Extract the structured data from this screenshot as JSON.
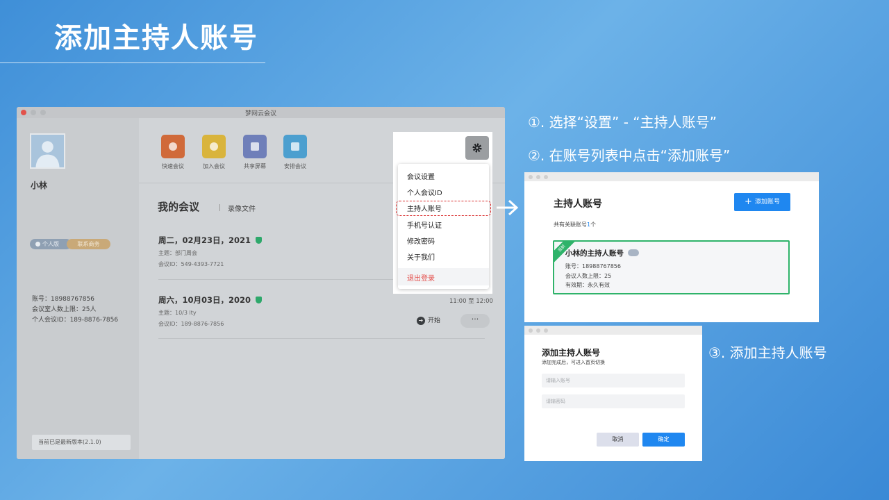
{
  "slide": {
    "title": "添加主持人账号"
  },
  "app": {
    "window_title": "梦网云会议",
    "user": {
      "name": "小林",
      "edition": "个人版",
      "business_contact": "联系商务",
      "account_line": "账号：18988767856",
      "capacity_line": "会议室人数上限：25人",
      "personal_id_line": "个人会议ID：189-8876-7856"
    },
    "version": "当前已是最新版本(2.1.0)",
    "quick_actions": [
      {
        "label": "快速会议",
        "color": "#d06a3a",
        "icon": "camera-icon"
      },
      {
        "label": "加入会议",
        "color": "#d9b43c",
        "icon": "plus-circle-icon"
      },
      {
        "label": "共享屏幕",
        "color": "#6f7fb9",
        "icon": "monitor-icon"
      },
      {
        "label": "安排会议",
        "color": "#4c9fcf",
        "icon": "calendar-icon"
      }
    ],
    "tabs": {
      "meetings": "我的会议",
      "recordings": "录像文件"
    },
    "meetings": [
      {
        "date": "周二，02月23日，2021",
        "topic": "主题：部门周会",
        "meeting_id": "会议ID：549-4393-7721"
      },
      {
        "date": "周六，10月03日，2020",
        "topic": "主题：10/3 lty",
        "meeting_id": "会议ID：189-8876-7856",
        "time": "11:00 至 12:00",
        "start": "开始",
        "more": "···"
      }
    ],
    "settings_menu": [
      "会议设置",
      "个人会议ID",
      "主持人账号",
      "手机号认证",
      "修改密码",
      "关于我们",
      "退出登录"
    ]
  },
  "steps": {
    "step1": "①. 选择“设置” - “主持人账号”",
    "step2": "②. 在账号列表中点击“添加账号”",
    "step3": "③. 添加主持人账号"
  },
  "host_panel": {
    "title": "主持人账号",
    "add_button": "添加账号",
    "linked_prefix": "共有关联账号",
    "linked_count": "1",
    "linked_suffix": "个",
    "card": {
      "ribbon": "当前",
      "name": "小林的主持人账号",
      "account": "账号：18988767856",
      "capacity": "会议人数上限：25",
      "validity": "有效期：永久有效"
    }
  },
  "add_dialog": {
    "title": "添加主持人账号",
    "subtitle": "添加完成后，可进入首页切换",
    "account_placeholder": "请输入账号",
    "password_placeholder": "请输密码",
    "cancel": "取消",
    "confirm": "确定"
  },
  "colors": {
    "accent": "#1f87f0",
    "active_green": "#2fb36a",
    "highlight_red": "#d92a2a",
    "logout_red": "#e4504d"
  }
}
